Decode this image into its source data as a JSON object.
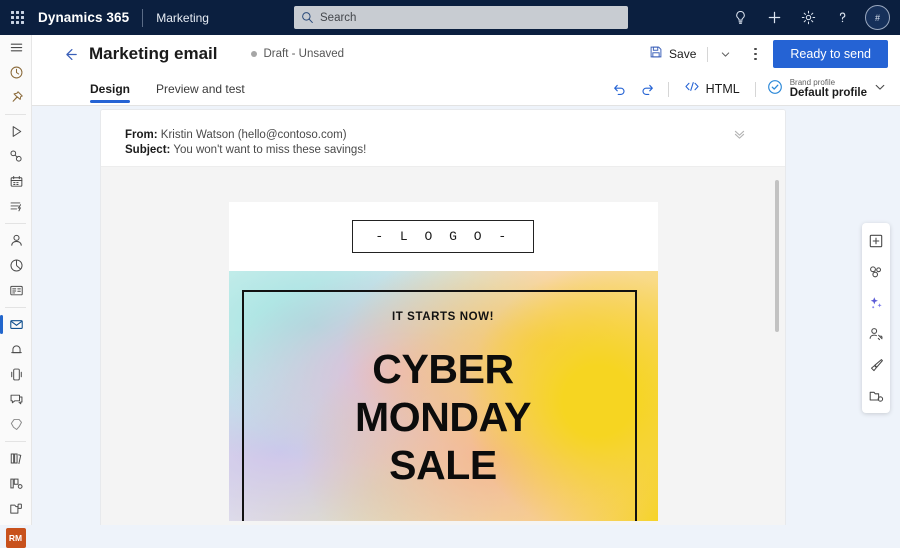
{
  "topbar": {
    "waffle_label": "app-launcher",
    "brand": "Dynamics 365",
    "app_name": "Marketing",
    "search": {
      "placeholder": "Search"
    },
    "icons": [
      {
        "name": "lightbulb-icon",
        "label": "Ideas"
      },
      {
        "name": "plus-icon",
        "label": "New"
      },
      {
        "name": "gear-icon",
        "label": "Settings"
      },
      {
        "name": "question-icon",
        "label": "Help"
      }
    ],
    "avatar_initials": "#"
  },
  "rail": {
    "items": [
      {
        "name": "hamburger-icon",
        "label": "Expand navigation"
      },
      {
        "name": "recent-clock-icon",
        "label": "Recent"
      },
      {
        "name": "pin-icon",
        "label": "Pinned"
      },
      {
        "name": "journeys-icon",
        "label": "Journeys"
      },
      {
        "name": "segments-icon",
        "label": "Segments"
      },
      {
        "name": "events-icon",
        "label": "Events"
      },
      {
        "name": "triggers-icon",
        "label": "Triggers"
      },
      {
        "name": "contacts-icon",
        "label": "Contacts"
      },
      {
        "name": "analytics-icon",
        "label": "Analytics"
      },
      {
        "name": "forms-icon",
        "label": "Forms"
      },
      {
        "name": "email-icon",
        "label": "Emails",
        "selected": true
      },
      {
        "name": "push-icon",
        "label": "Push notifications"
      },
      {
        "name": "sms-icon",
        "label": "Text messages"
      },
      {
        "name": "chat-icon",
        "label": "Chat"
      },
      {
        "name": "custom-channel-icon",
        "label": "Custom channels"
      },
      {
        "name": "library-icon",
        "label": "Library"
      },
      {
        "name": "templates-icon",
        "label": "Templates"
      },
      {
        "name": "assets-icon",
        "label": "Assets"
      }
    ],
    "badge": "RM"
  },
  "command": {
    "back_label": "Back",
    "title": "Marketing email",
    "status": "Draft - Unsaved",
    "save_label": "Save",
    "overflow_label": "More commands",
    "primary_label": "Ready to send"
  },
  "tabs": [
    {
      "label": "Design",
      "active": true
    },
    {
      "label": "Preview and test",
      "active": false
    }
  ],
  "toolbar": {
    "undo_label": "Undo",
    "redo_label": "Redo",
    "html_label": "HTML",
    "brand_profile_caption": "Brand profile",
    "brand_profile_value": "Default profile"
  },
  "email": {
    "from_label": "From:",
    "from_value": "Kristin Watson (hello@contoso.com)",
    "subject_label": "Subject:",
    "subject_value": "You won't want to miss these savings!",
    "collapse_label": "Collapse header",
    "logo_text": "-  L O G O  -",
    "hero_kicker": "IT STARTS NOW!",
    "hero_line1": "CYBER",
    "hero_line2": "MONDAY",
    "hero_line3": "SALE"
  },
  "right_tools": [
    {
      "name": "add-element-icon",
      "label": "Add element"
    },
    {
      "name": "layout-icon",
      "label": "Layouts"
    },
    {
      "name": "ai-sparkle-icon",
      "label": "Copilot"
    },
    {
      "name": "personalization-icon",
      "label": "Personalization"
    },
    {
      "name": "styles-brush-icon",
      "label": "Styles"
    },
    {
      "name": "assets-library-icon",
      "label": "Assets"
    }
  ],
  "colors": {
    "header_bg": "#0b1f3f",
    "accent": "#2563d4",
    "badge": "#c8511c",
    "stage_bg": "#eef3fa"
  }
}
